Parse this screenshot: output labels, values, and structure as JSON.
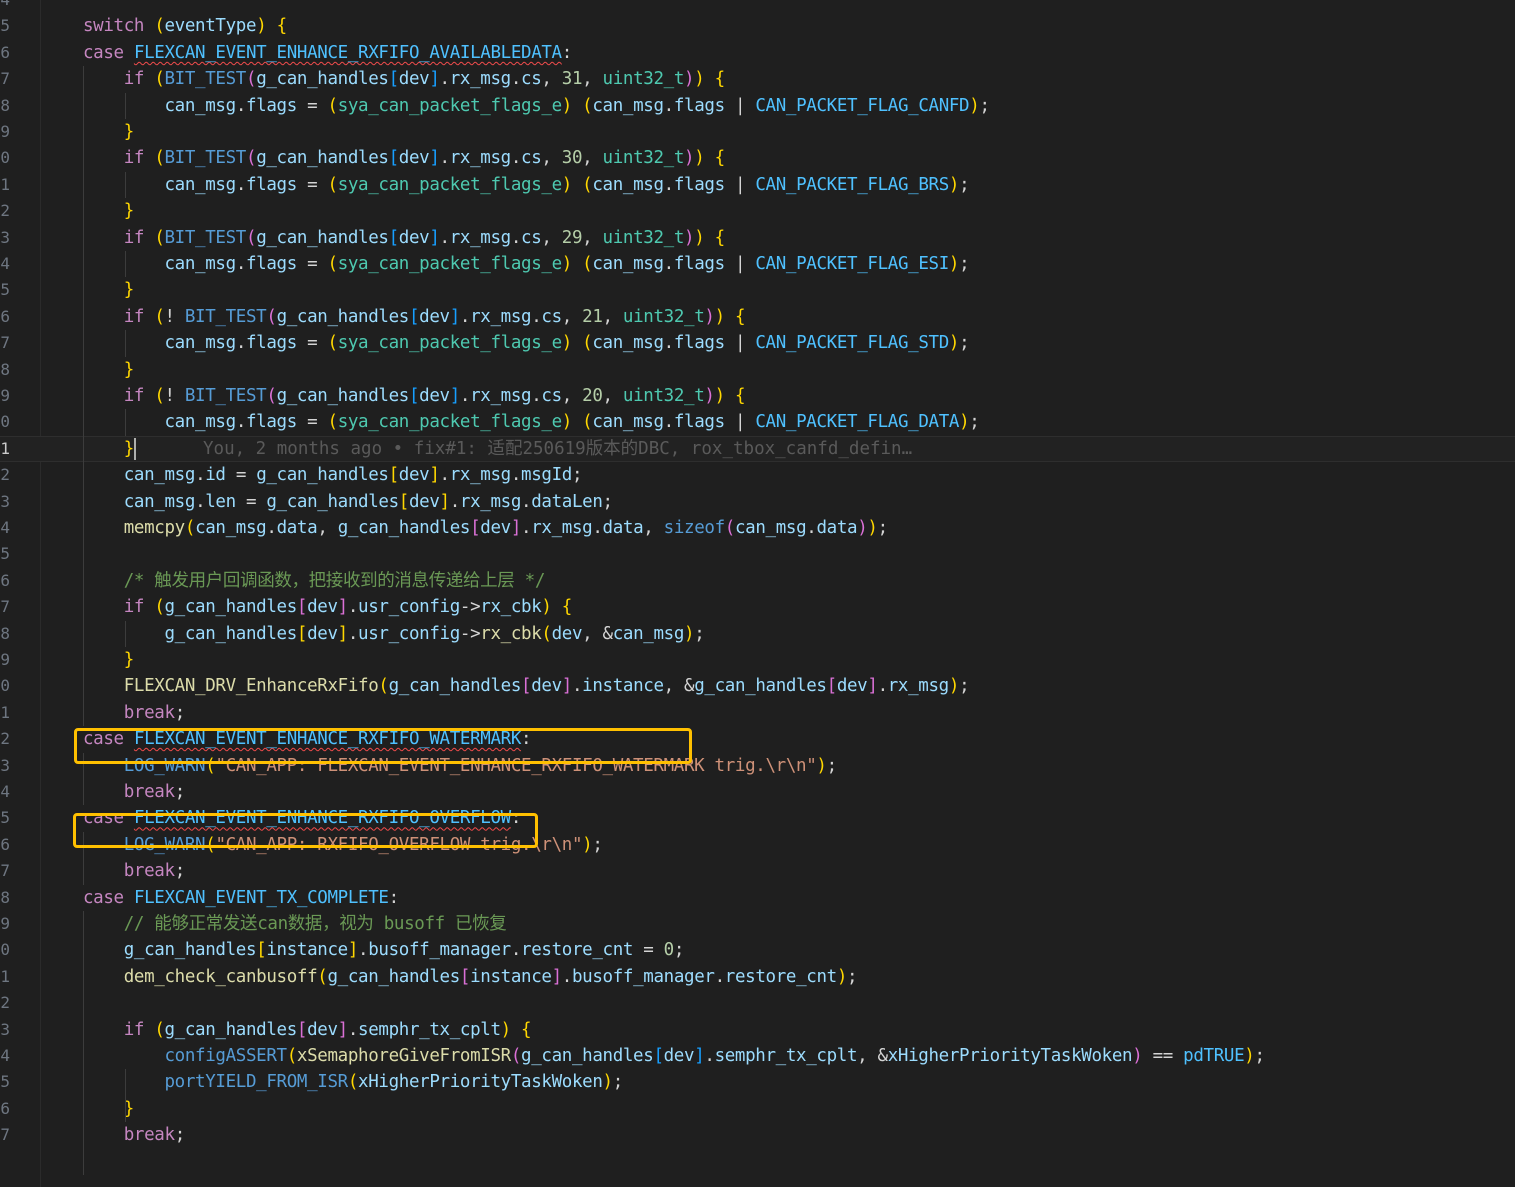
{
  "editor": {
    "language": "c",
    "theme_background": "#1f1f1f",
    "highlight_color": "#ffc000",
    "current_line": "1",
    "blame_annotation": "You, 2 months ago • fix#1: 适配250619版本的DBC, rox_tbox_canfd_defin…",
    "line_numbers": [
      "4",
      "5",
      "6",
      "7",
      "8",
      "9",
      "0",
      "1",
      "2",
      "3",
      "4",
      "5",
      "6",
      "7",
      "8",
      "9",
      "0",
      "1",
      "2",
      "3",
      "4",
      "5",
      "6",
      "7",
      "8",
      "9",
      "0",
      "1",
      "2",
      "3",
      "4",
      "5",
      "6",
      "7",
      "8",
      "9",
      "0",
      "1",
      "2",
      "3",
      "4",
      "5",
      "6",
      "7"
    ],
    "lines": [
      "",
      "switch (eventType) {",
      "case FLEXCAN_EVENT_ENHANCE_RXFIFO_AVAILABLEDATA:",
      "    if (BIT_TEST(g_can_handles[dev].rx_msg.cs, 31, uint32_t)) {",
      "        can_msg.flags = (sya_can_packet_flags_e) (can_msg.flags | CAN_PACKET_FLAG_CANFD);",
      "    }",
      "    if (BIT_TEST(g_can_handles[dev].rx_msg.cs, 30, uint32_t)) {",
      "        can_msg.flags = (sya_can_packet_flags_e) (can_msg.flags | CAN_PACKET_FLAG_BRS);",
      "    }",
      "    if (BIT_TEST(g_can_handles[dev].rx_msg.cs, 29, uint32_t)) {",
      "        can_msg.flags = (sya_can_packet_flags_e) (can_msg.flags | CAN_PACKET_FLAG_ESI);",
      "    }",
      "    if (! BIT_TEST(g_can_handles[dev].rx_msg.cs, 21, uint32_t)) {",
      "        can_msg.flags = (sya_can_packet_flags_e) (can_msg.flags | CAN_PACKET_FLAG_STD);",
      "    }",
      "    if (! BIT_TEST(g_can_handles[dev].rx_msg.cs, 20, uint32_t)) {",
      "        can_msg.flags = (sya_can_packet_flags_e) (can_msg.flags | CAN_PACKET_FLAG_DATA);",
      "    }",
      "    can_msg.id = g_can_handles[dev].rx_msg.msgId;",
      "    can_msg.len = g_can_handles[dev].rx_msg.dataLen;",
      "    memcpy(can_msg.data, g_can_handles[dev].rx_msg.data, sizeof(can_msg.data));",
      "",
      "    /* 触发用户回调函数，把接收到的消息传递给上层 */",
      "    if (g_can_handles[dev].usr_config->rx_cbk) {",
      "        g_can_handles[dev].usr_config->rx_cbk(dev, &can_msg);",
      "    }",
      "    FLEXCAN_DRV_EnhanceRxFifo(g_can_handles[dev].instance, &g_can_handles[dev].rx_msg);",
      "    break;",
      "case FLEXCAN_EVENT_ENHANCE_RXFIFO_WATERMARK:",
      "    LOG_WARN(\"CAN_APP: FLEXCAN_EVENT_ENHANCE_RXFIFO_WATERMARK trig.\\r\\n\");",
      "    break;",
      "case FLEXCAN_EVENT_ENHANCE_RXFIFO_OVERFLOW:",
      "    LOG_WARN(\"CAN_APP: RXFIFO_OVERFLOW trig.\\r\\n\");",
      "    break;",
      "case FLEXCAN_EVENT_TX_COMPLETE:",
      "    // 能够正常发送can数据，视为 busoff 已恢复",
      "    g_can_handles[instance].busoff_manager.restore_cnt = 0;",
      "    dem_check_canbusoff(g_can_handles[instance].busoff_manager.restore_cnt);",
      "",
      "    if (g_can_handles[dev].semphr_tx_cplt) {",
      "        configASSERT(xSemaphoreGiveFromISR(g_can_handles[dev].semphr_tx_cplt, &xHigherPriorityTaskWoken) == pdTRUE);",
      "        portYIELD_FROM_ISR(xHigherPriorityTaskWoken);",
      "    }",
      "    break;"
    ]
  }
}
